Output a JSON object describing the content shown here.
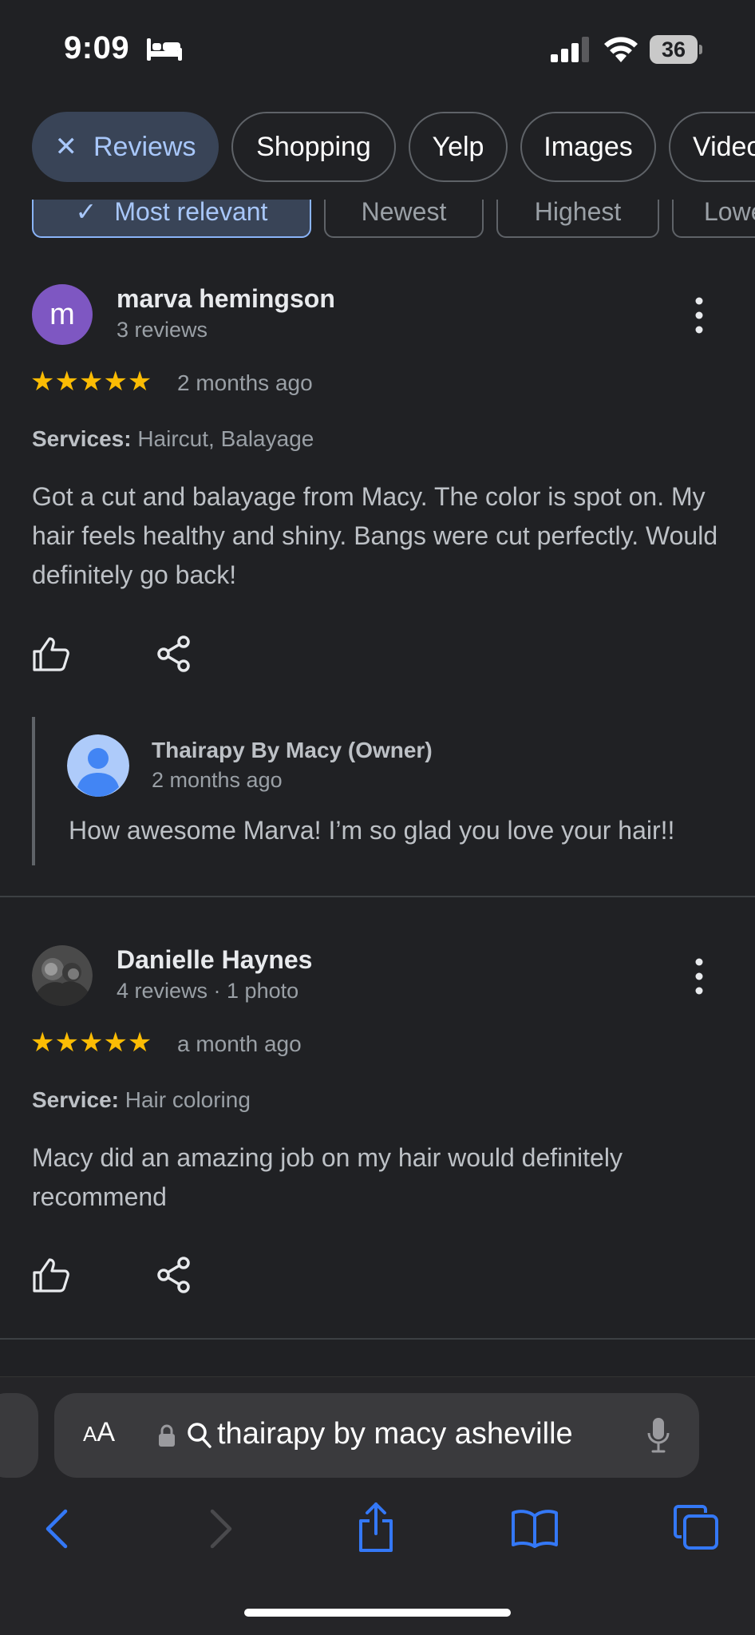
{
  "status_bar": {
    "time": "9:09",
    "battery": "36"
  },
  "tabs": [
    {
      "label": "Reviews",
      "active": true
    },
    {
      "label": "Shopping"
    },
    {
      "label": "Yelp"
    },
    {
      "label": "Images"
    },
    {
      "label": "Videos"
    }
  ],
  "sort_options": [
    {
      "label": "Most relevant",
      "active": true
    },
    {
      "label": "Newest"
    },
    {
      "label": "Highest"
    },
    {
      "label": "Lowest"
    }
  ],
  "reviews": [
    {
      "avatar_letter": "m",
      "name": "marva hemingson",
      "meta": "3 reviews",
      "stars": "★★★★★",
      "rating": 5,
      "time_ago": "2 months ago",
      "services_label": "Services:",
      "services": "Haircut, Balayage",
      "text": "Got a cut and balayage from Macy. The color is spot on. My hair feels healthy and shiny. Bangs were cut perfectly. Would definitely go back!",
      "owner_reply": {
        "name": "Thairapy By Macy (Owner)",
        "time_ago": "2 months ago",
        "text": "How awesome Marva! I’m so glad you love your hair!!"
      }
    },
    {
      "name": "Danielle Haynes",
      "meta": "4 reviews · 1 photo",
      "stars": "★★★★★",
      "rating": 5,
      "time_ago": "a month ago",
      "services_label": "Service:",
      "services": "Hair coloring",
      "text": "Macy did an amazing job on my hair would definitely recommend"
    }
  ],
  "safari": {
    "aa_large": "A",
    "aa_small": "A",
    "url_text": "thairapy by macy asheville"
  },
  "colors": {
    "background": "#202124",
    "accent": "#a8c7fa",
    "star": "#fbbc04",
    "safari_blue": "#3478f6"
  }
}
